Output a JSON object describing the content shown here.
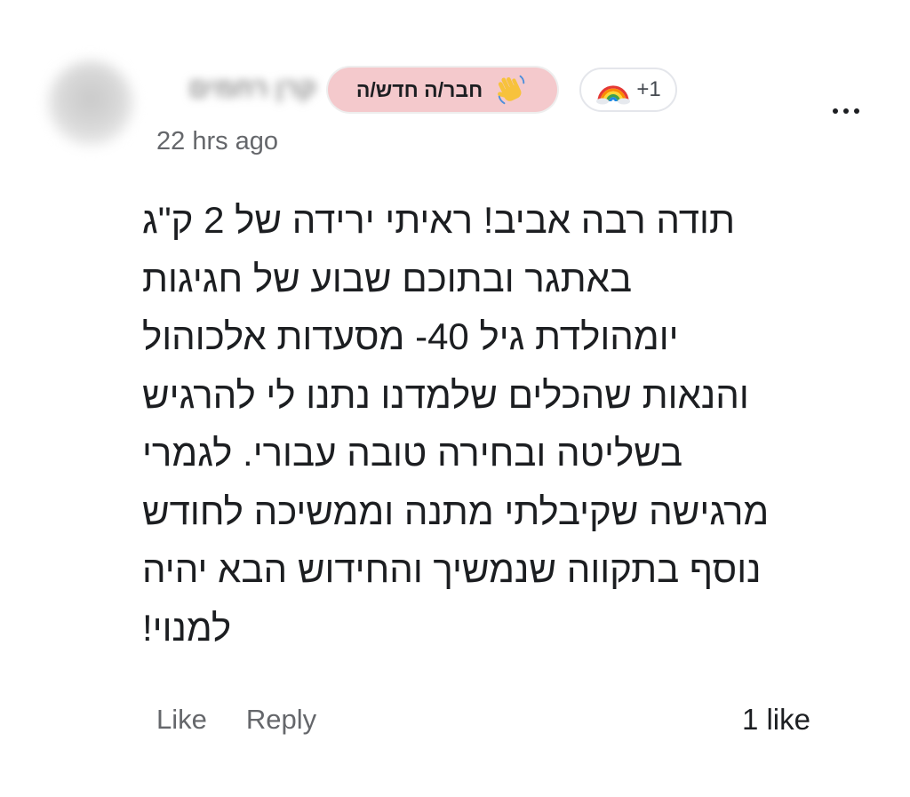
{
  "comment": {
    "author_name": "קרן רחמים",
    "author_badge": "חבר/ה חדש/ה",
    "extra_badges": "+1",
    "timestamp": "22 hrs ago",
    "text_lines": [
      "תודה רבה אביב! ראיתי ירידה של 2 ק\"ג",
      "באתגר ובתוכם שבוע של חגיגות",
      "יומהולדת גיל 40- מסעדות אלכוהול",
      "והנאות שהכלים שלמדנו נתנו לי להרגיש",
      "בשליטה ובחירה טובה עבורי. לגמרי",
      "מרגישה שקיבלתי מתנה וממשיכה לחודש",
      "נוסף בתקווה שנמשיך והחידוש הבא יהיה",
      "למנוי!"
    ],
    "actions": {
      "like_label": "Like",
      "reply_label": "Reply"
    },
    "like_count": "1 like"
  },
  "icons": {
    "badge_new": "waving-hand-icon",
    "badge_extra": "rainbow-icon",
    "menu": "more-options-icon"
  },
  "colors": {
    "badge_new_background": "#f4c9cc",
    "secondary_text": "#65676b",
    "primary_text": "#1c1e21"
  }
}
